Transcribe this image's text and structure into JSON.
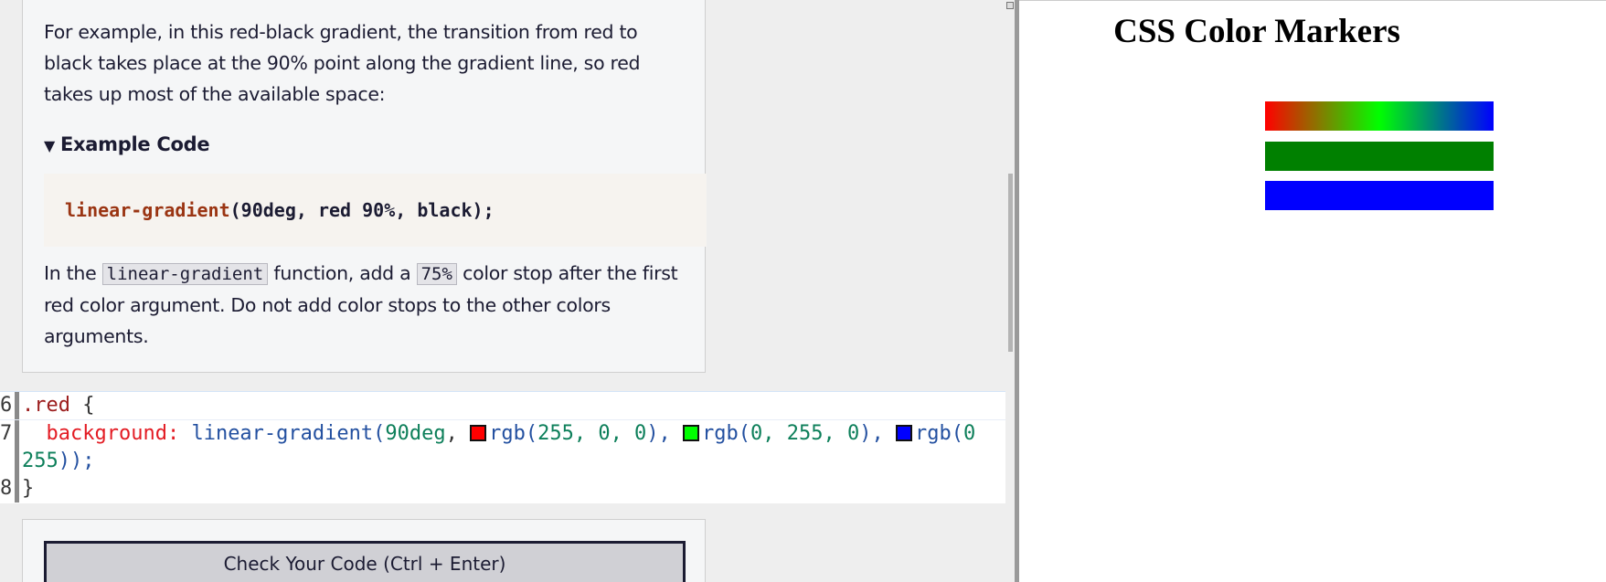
{
  "lesson": {
    "para1": "For example, in this red-black gradient, the transition from red to black takes place at the 90% point along the gradient line, so red takes up most of the available space:",
    "example_summary": "Example Code",
    "example_code": {
      "fn": "linear-gradient",
      "args": "(90deg, red 90%, black);"
    },
    "para2": {
      "t1": "In the ",
      "code1": "linear-gradient",
      "t2": " function, add a ",
      "code2": "75%",
      "t3": " color stop after the first red color argument. Do not add color stops to the other colors arguments."
    }
  },
  "editor": {
    "lines": [
      {
        "num": "6",
        "selector": ".red",
        "brace": " {"
      },
      {
        "num": "7",
        "prop": "background:",
        "fn": "linear-gradient(",
        "arg1": "90deg",
        "c1": ", ",
        "rgb1": "rgb(",
        "n1": "255, 0, 0",
        "close1": "), ",
        "rgb2": "rgb(",
        "n2": "0, 255, 0",
        "close2": "), ",
        "rgb3": "rgb(",
        "n3": "0"
      },
      {
        "num": "",
        "cont_num": "255",
        "cont_tail": "));"
      },
      {
        "num": "8",
        "brace": "}"
      }
    ],
    "swatch_colors": [
      "#ff0000",
      "#00ff00",
      "#0000ff"
    ]
  },
  "actions": {
    "check_label": "Check Your Code (Ctrl + Enter)"
  },
  "preview": {
    "title": "CSS Color Markers",
    "bars": {
      "red": "linear-gradient(90deg, #ff0000, #00ff00, #0000ff)",
      "green": "#008000",
      "blue": "#0000ff"
    }
  }
}
